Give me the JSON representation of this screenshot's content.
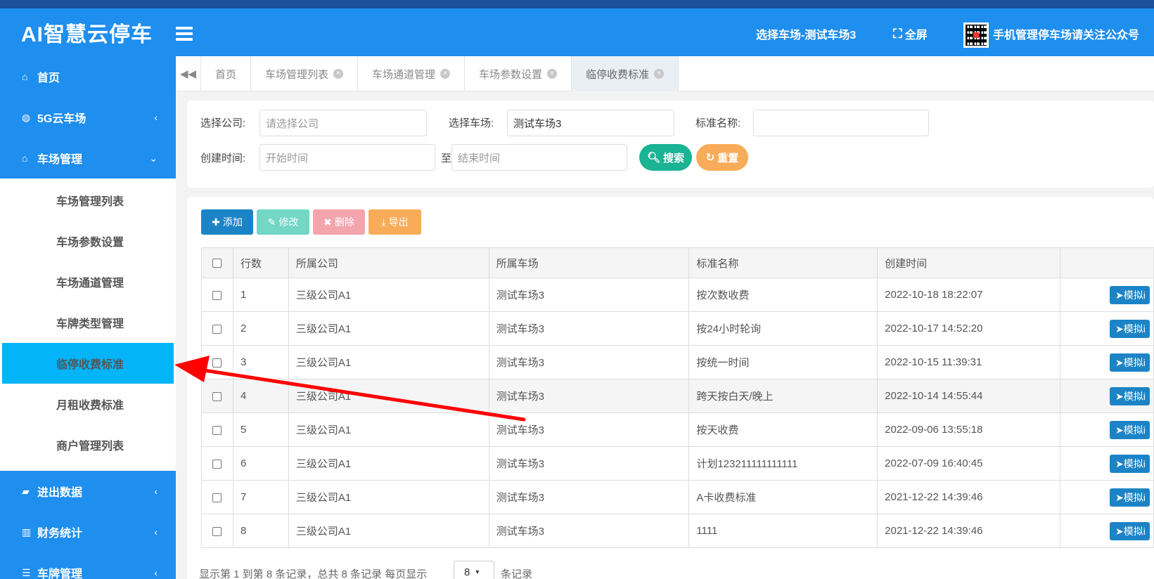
{
  "header": {
    "logo": "AI智慧云停车",
    "select_park": "选择车场-测试车场3",
    "fullscreen": "全屏",
    "wechat": "手机管理停车场请关注公众号"
  },
  "sidebar": {
    "home": "首页",
    "cloud_park": "5G云车场",
    "park_mgmt": "车场管理",
    "sub_items": [
      "车场管理列表",
      "车场参数设置",
      "车场通道管理",
      "车牌类型管理",
      "临停收费标准",
      "月租收费标准",
      "商户管理列表"
    ],
    "in_out": "进出数据",
    "finance": "财务统计",
    "plate_mgmt": "车牌管理"
  },
  "tabs": [
    "首页",
    "车场管理列表",
    "车场通道管理",
    "车场参数设置",
    "临停收费标准"
  ],
  "search": {
    "company_label": "选择公司:",
    "company_placeholder": "请选择公司",
    "park_label": "选择车场:",
    "park_value": "测试车场3",
    "name_label": "标准名称:",
    "created_label": "创建时间:",
    "start_placeholder": "开始时间",
    "to": "至",
    "end_placeholder": "结束时间",
    "search_btn": "搜索",
    "reset_btn": "重置"
  },
  "toolbar": {
    "add": "添加",
    "edit": "修改",
    "delete": "删除",
    "export": "导出"
  },
  "table": {
    "headers": [
      "行数",
      "所属公司",
      "所属车场",
      "标准名称",
      "创建时间"
    ],
    "rows": [
      {
        "no": "1",
        "company": "三级公司A1",
        "park": "测试车场3",
        "name": "按次数收费",
        "time": "2022-10-18 18:22:07"
      },
      {
        "no": "2",
        "company": "三级公司A1",
        "park": "测试车场3",
        "name": "按24小时轮询",
        "time": "2022-10-17 14:52:20"
      },
      {
        "no": "3",
        "company": "三级公司A1",
        "park": "测试车场3",
        "name": "按统一时间",
        "time": "2022-10-15 11:39:31"
      },
      {
        "no": "4",
        "company": "三级公司A1",
        "park": "测试车场3",
        "name": "跨天按白天/晚上",
        "time": "2022-10-14 14:55:44"
      },
      {
        "no": "5",
        "company": "三级公司A1",
        "park": "测试车场3",
        "name": "按天收费",
        "time": "2022-09-06 13:55:18"
      },
      {
        "no": "6",
        "company": "三级公司A1",
        "park": "测试车场3",
        "name": "计划123211111111111",
        "time": "2022-07-09 16:40:45"
      },
      {
        "no": "7",
        "company": "三级公司A1",
        "park": "测试车场3",
        "name": "A卡收费标准",
        "time": "2021-12-22 14:39:46"
      },
      {
        "no": "8",
        "company": "三级公司A1",
        "park": "测试车场3",
        "name": "1111",
        "time": "2021-12-22 14:39:46"
      }
    ],
    "row_action": "模拟i"
  },
  "footer": {
    "summary": "显示第 1 到第 8 条记录，总共 8 条记录  每页显示",
    "page_size": "8",
    "suffix": "条记录"
  },
  "colors": {
    "brand": "#1e8eef",
    "active_menu": "#04b4f8",
    "search": "#1ab394",
    "reset": "#f8ac59",
    "annotation": "#ff0000"
  }
}
